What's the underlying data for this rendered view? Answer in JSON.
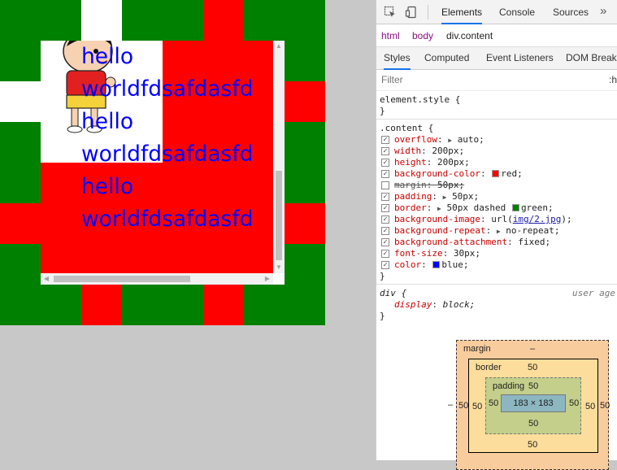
{
  "page": {
    "content_lines": [
      "hello",
      "worldfdsafdasfd",
      "hello",
      "worldfdsafdasfd",
      "hello",
      "worldfdsafdasfd"
    ],
    "colors": {
      "green": "#008000",
      "red": "#ff0000",
      "blue": "#0000ff"
    }
  },
  "devtools": {
    "tabs": [
      "Elements",
      "Console",
      "Sources"
    ],
    "tab_more": "»",
    "breadcrumbs": [
      "html",
      "body",
      "div.content"
    ],
    "subtabs": [
      "Styles",
      "Computed",
      "Event Listeners",
      "DOM Breakp"
    ],
    "filter_placeholder": "Filter",
    "filter_hov": ":h",
    "element_style": {
      "selector": "element.style {",
      "close": "}"
    },
    "content_rule": {
      "selector": ".content {",
      "close": "}",
      "declarations": [
        {
          "name": "overflow",
          "value": "auto;"
        },
        {
          "name": "width",
          "value": "200px;"
        },
        {
          "name": "height",
          "value": "200px;"
        },
        {
          "name": "background-color",
          "value": "red;"
        },
        {
          "name": "margin",
          "value": "50px;"
        },
        {
          "name": "padding",
          "value": "50px;"
        },
        {
          "name": "border",
          "value": "50px dashed"
        },
        {
          "name": "border_color",
          "value": "green;"
        },
        {
          "name": "background-image",
          "value": "url("
        },
        {
          "name": "bg_link",
          "value": "img/2.jpg"
        },
        {
          "name": "bg_close",
          "value": ");"
        },
        {
          "name": "background-repeat",
          "value": "no-repeat;"
        },
        {
          "name": "background-attachment",
          "value": "fixed;"
        },
        {
          "name": "font-size",
          "value": "30px;"
        },
        {
          "name": "color",
          "value": "blue;"
        }
      ]
    },
    "ua_rule": {
      "selector": "div {",
      "origin": "user age",
      "name": "display",
      "value": "block;",
      "close": "}"
    },
    "box_model": {
      "margin_label": "margin",
      "margin_top": "–",
      "margin_left": "50",
      "margin_right": "50",
      "margin_bottom": "",
      "border_label": "border",
      "border_top": "50",
      "border_left": "50",
      "border_right": "50",
      "border_bottom": "50",
      "padding_label": "padding",
      "padding_top": "50",
      "padding_left": "50",
      "padding_right": "50",
      "padding_bottom": "50",
      "content_size": "183 × 183",
      "outer_left": "–",
      "outer_right": "–"
    }
  }
}
